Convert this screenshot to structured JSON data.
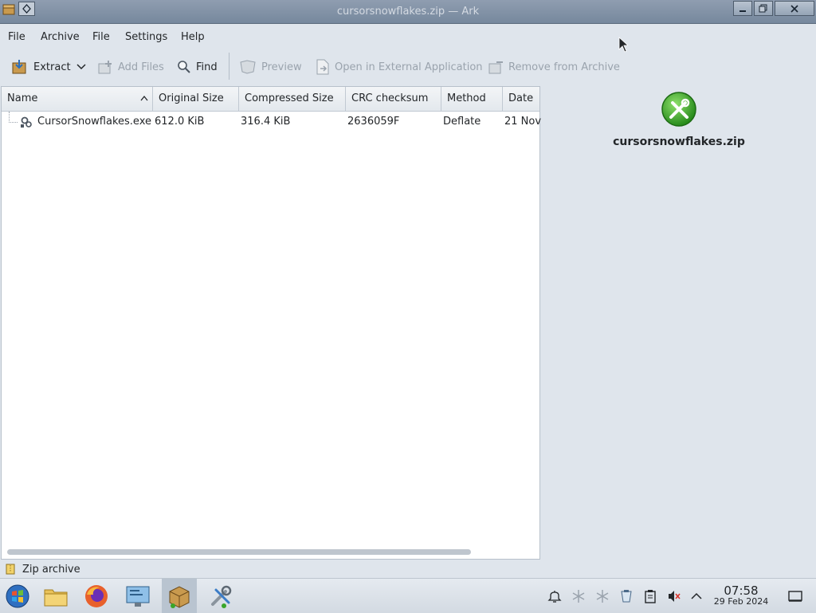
{
  "window": {
    "title": "cursorsnowflakes.zip — Ark"
  },
  "menubar": [
    "File",
    "Archive",
    "File",
    "Settings",
    "Help"
  ],
  "toolbar": {
    "extract": "Extract",
    "add_files": "Add Files",
    "find": "Find",
    "preview": "Preview",
    "open_external": "Open in External Application",
    "remove": "Remove from Archive"
  },
  "table": {
    "columns": [
      "Name",
      "Original Size",
      "Compressed Size",
      "CRC checksum",
      "Method",
      "Date"
    ],
    "rows": [
      {
        "name": "CursorSnowflakes.exe",
        "original_size": "612.0 KiB",
        "compressed_size": "316.4 KiB",
        "crc": "2636059F",
        "method": "Deflate",
        "date": "21 Nov"
      }
    ]
  },
  "info_panel": {
    "filename": "cursorsnowflakes.zip",
    "icon": "green-tools-icon"
  },
  "status": {
    "text": "Zip archive"
  },
  "taskbar": {
    "clock_time": "07:58",
    "clock_date": "29 Feb 2024"
  },
  "colors": {
    "window_bg": "#dfe5ec",
    "titlebar": "#8394a8",
    "accent_green": "#3aa62a"
  }
}
